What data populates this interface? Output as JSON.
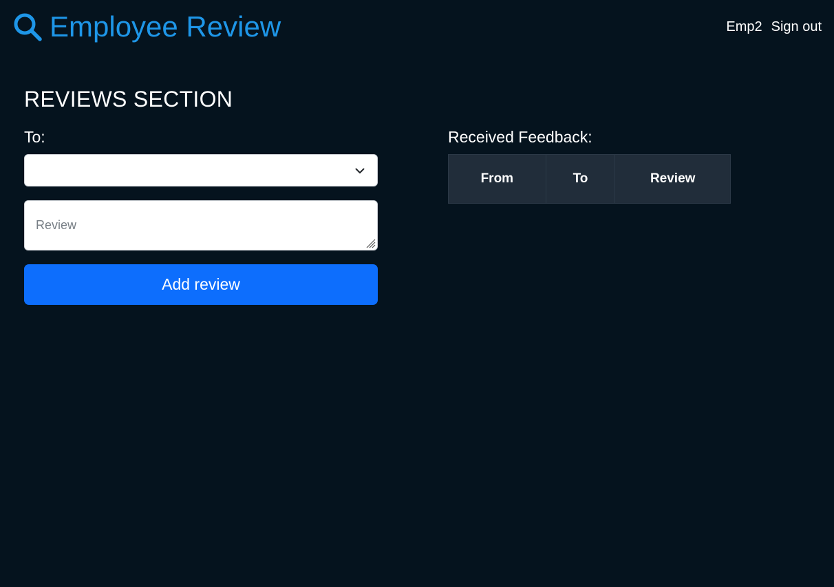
{
  "header": {
    "brand_title": "Employee Review",
    "brand_icon": "search-icon",
    "user_name": "Emp2",
    "sign_out_label": "Sign out"
  },
  "reviews_section": {
    "title": "REVIEWS SECTION",
    "to_label": "To:",
    "to_select_value": "",
    "review_placeholder": "Review",
    "add_button_label": "Add review"
  },
  "feedback": {
    "label": "Received Feedback:",
    "columns": [
      "From",
      "To",
      "Review"
    ],
    "rows": []
  },
  "colors": {
    "background": "#05131e",
    "brand": "#1e96e8",
    "primary_button": "#0d6efd",
    "table_header": "#212d3a"
  }
}
